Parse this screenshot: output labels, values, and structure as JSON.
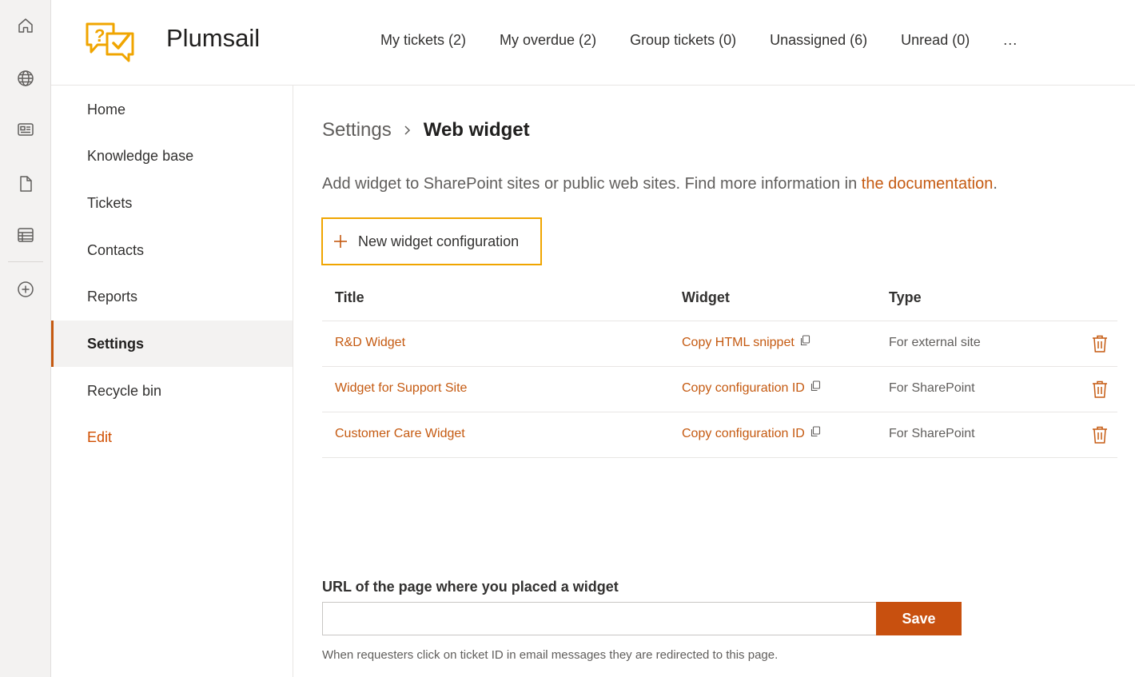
{
  "colors": {
    "accent": "#c55a11",
    "save": "#c8500f",
    "highlight": "#f0a500",
    "rail": "#f3f2f1"
  },
  "rail": {
    "items": [
      {
        "icon": "home-icon"
      },
      {
        "icon": "globe-icon"
      },
      {
        "icon": "news-icon"
      },
      {
        "icon": "document-icon"
      },
      {
        "icon": "list-icon"
      },
      {
        "icon": "add-circle-icon"
      }
    ]
  },
  "header": {
    "brand": "Plumsail",
    "nav": [
      "My tickets (2)",
      "My overdue (2)",
      "Group tickets (0)",
      "Unassigned (6)",
      "Unread (0)"
    ],
    "more": "..."
  },
  "sidebar": {
    "items": [
      "Home",
      "Knowledge base",
      "Tickets",
      "Contacts",
      "Reports",
      "Settings",
      "Recycle bin"
    ],
    "active": "Settings",
    "edit": "Edit"
  },
  "breadcrumb": {
    "parent": "Settings",
    "current": "Web widget"
  },
  "description": {
    "text": "Add widget to SharePoint sites or public web sites. Find more information in ",
    "link": "the documentation",
    "end": "."
  },
  "new_button": {
    "label": "New widget configuration"
  },
  "table": {
    "headers": {
      "title": "Title",
      "widget": "Widget",
      "type": "Type"
    },
    "rows": [
      {
        "title": "R&D Widget",
        "widget": "Copy HTML snippet",
        "type": "For external site"
      },
      {
        "title": "Widget for Support Site",
        "widget": "Copy configuration ID",
        "type": "For SharePoint"
      },
      {
        "title": "Customer Care Widget",
        "widget": "Copy configuration ID",
        "type": "For SharePoint"
      }
    ]
  },
  "url_section": {
    "label": "URL of the page where you placed a widget",
    "value": "",
    "save": "Save",
    "hint": "When requesters click on ticket ID in email messages they are redirected to this page."
  }
}
